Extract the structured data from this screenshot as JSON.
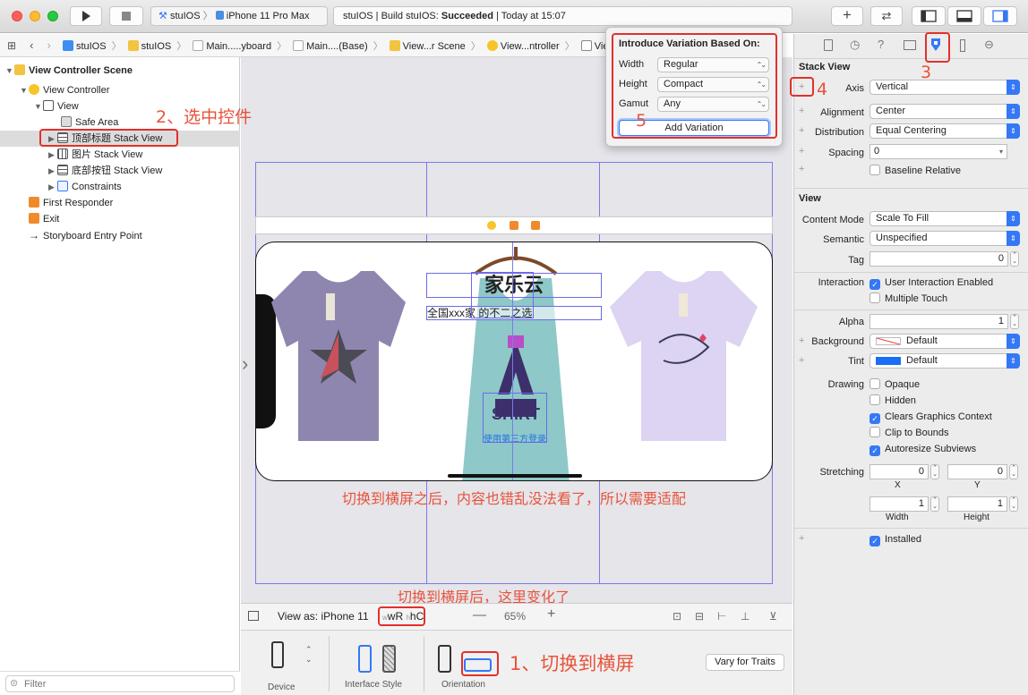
{
  "toolbar": {
    "scheme_project": "stuIOS",
    "scheme_device": "iPhone 11 Pro Max",
    "status_prefix": "stuIOS | Build stuIOS: ",
    "status_result": "Succeeded",
    "status_suffix": " | Today at 15:07"
  },
  "jumpbar": {
    "items": [
      "stuIOS",
      "stuIOS",
      "Main.....yboard",
      "Main....(Base)",
      "View...r Scene",
      "View...ntroller",
      "View"
    ]
  },
  "outline": {
    "scene": "View Controller Scene",
    "controller": "View Controller",
    "view": "View",
    "safe_area": "Safe Area",
    "stack1": "顶部标题 Stack View",
    "stack2": "图片 Stack View",
    "stack3": "底部按钮 Stack View",
    "constraints": "Constraints",
    "first_responder": "First Responder",
    "exit": "Exit",
    "entry_point": "Storyboard Entry Point",
    "filter_placeholder": "Filter"
  },
  "canvas": {
    "title_text": "家乐云",
    "subtitle_text": "全国xxx家      的不二之选",
    "shirt_text": "SHIRT",
    "login_text": "使用第三方登录",
    "view_as": "View as: iPhone 11",
    "size_class_w": "wR",
    "size_class_h": "hC",
    "zoom": "65%",
    "device_label": "Device",
    "interface_style_label": "Interface Style",
    "orientation_label": "Orientation",
    "vary_for_traits": "Vary for Traits"
  },
  "popover": {
    "title": "Introduce Variation Based On:",
    "width_label": "Width",
    "width_value": "Regular",
    "height_label": "Height",
    "height_value": "Compact",
    "gamut_label": "Gamut",
    "gamut_value": "Any",
    "add_button": "Add Variation"
  },
  "annotations": {
    "n1": "1、切换到横屏",
    "n2": "2、选中控件",
    "n3": "3",
    "n4": "4",
    "n5": "5",
    "landscape_note": "切换到横屏之后，内容也错乱没法看了，所以需要适配",
    "changed_note": "切换到横屏后，这里变化了"
  },
  "inspector": {
    "stack_section": "Stack View",
    "axis_label": "Axis",
    "axis_value": "Vertical",
    "alignment_label": "Alignment",
    "alignment_value": "Center",
    "distribution_label": "Distribution",
    "distribution_value": "Equal Centering",
    "spacing_label": "Spacing",
    "spacing_value": "0",
    "baseline_label": "Baseline Relative",
    "view_section": "View",
    "content_mode_label": "Content Mode",
    "content_mode_value": "Scale To Fill",
    "semantic_label": "Semantic",
    "semantic_value": "Unspecified",
    "tag_label": "Tag",
    "tag_value": "0",
    "interaction_label": "Interaction",
    "user_interaction": "User Interaction Enabled",
    "multiple_touch": "Multiple Touch",
    "alpha_label": "Alpha",
    "alpha_value": "1",
    "background_label": "Background",
    "background_value": "Default",
    "tint_label": "Tint",
    "tint_value": "Default",
    "drawing_label": "Drawing",
    "opaque": "Opaque",
    "hidden": "Hidden",
    "clears_graphics": "Clears Graphics Context",
    "clip_bounds": "Clip to Bounds",
    "autoresize": "Autoresize Subviews",
    "stretching_label": "Stretching",
    "stretch_x": "0",
    "stretch_y": "0",
    "x_label": "X",
    "y_label": "Y",
    "stretch_w": "1",
    "stretch_h": "1",
    "width_label": "Width",
    "height_label": "Height",
    "installed": "Installed"
  },
  "colors": {
    "accent": "#3478f6",
    "annotation": "#e8533b",
    "succeeded": "#222222"
  }
}
